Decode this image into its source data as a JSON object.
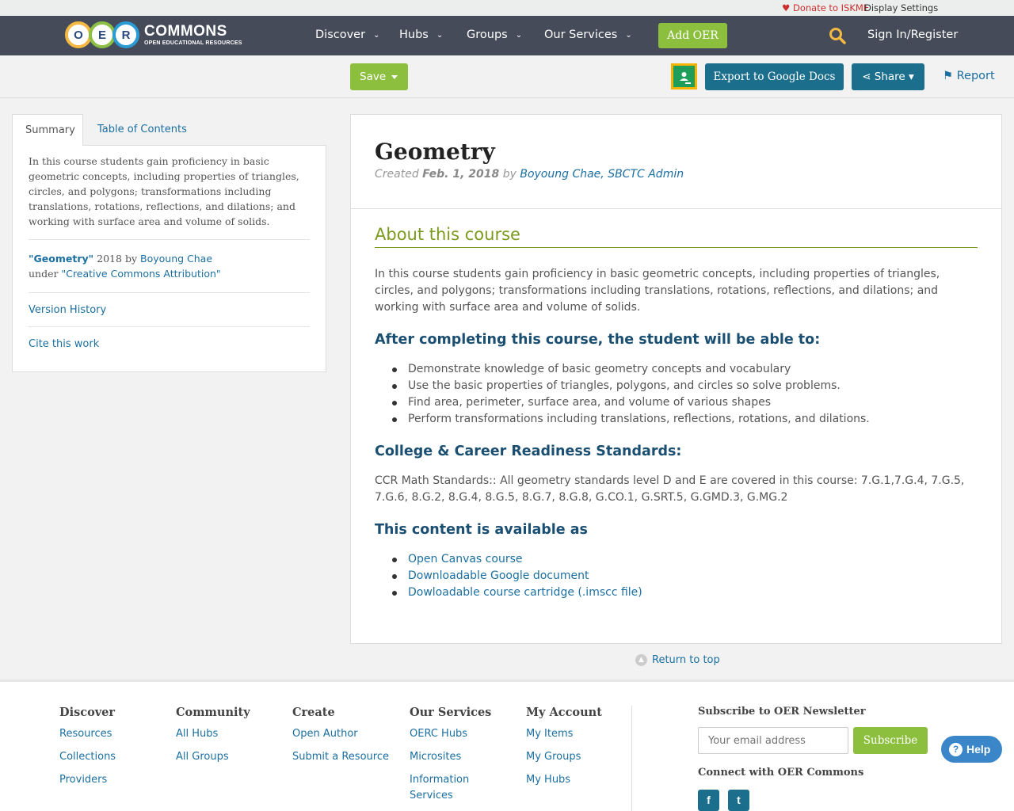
{
  "utility": {
    "donate": "Donate to ISKME",
    "display_settings": "Display Settings"
  },
  "logo": {
    "letters": [
      "O",
      "E",
      "R"
    ],
    "name": "COMMONS",
    "tagline": "OPEN EDUCATIONAL RESOURCES"
  },
  "nav": {
    "items": [
      {
        "label": "Discover"
      },
      {
        "label": "Hubs"
      },
      {
        "label": "Groups"
      },
      {
        "label": "Our Services"
      }
    ],
    "add_oer": "Add OER",
    "sign_in": "Sign In/Register"
  },
  "toolbar": {
    "save": "Save",
    "export": "Export to Google Docs",
    "share": "Share",
    "report": "Report"
  },
  "sidebar": {
    "tabs": [
      {
        "label": "Summary"
      },
      {
        "label": "Table of Contents"
      }
    ],
    "summary": "In this course students gain proficiency in basic geometric concepts, including properties of triangles, circles, and polygons; transformations including translations, rotations, reflections, and dilations; and working with surface area and volume of solids.",
    "attribution": {
      "title": "\"Geometry\"",
      "year": "2018",
      "by": "by",
      "author": "Boyoung Chae",
      "under": "under",
      "license": "\"Creative Commons Attribution\""
    },
    "version_history": "Version History",
    "cite": "Cite this work"
  },
  "resource": {
    "title": "Geometry",
    "created_label": "Created",
    "created_date": "Feb. 1, 2018",
    "by_label": "by",
    "authors": "Boyoung Chae, SBCTC Admin",
    "about_heading": "About this course",
    "about_text": "In this course students gain proficiency in basic geometric concepts, including properties of triangles, circles, and polygons; transformations including translations, rotations, reflections, and dilations; and working with surface area and volume of solids.",
    "outcomes_heading": "After completing this course, the student will be able to:",
    "outcomes": [
      "Demonstrate knowledge of basic geometry concepts and vocabulary",
      "Use the basic properties of triangles, polygons, and circles so solve problems.",
      "Find area, perimeter, surface area, and volume of various shapes",
      "Perform transformations including translations, reflections, rotations, and dilations."
    ],
    "standards_heading": "College & Career Readiness Standards:",
    "standards_text": "CCR Math Standards:: All geometry standards level D and E are covered in this course: 7.G.1,7.G.4, 7.G.5, 7.G.6, 8.G.2, 8.G.4, 8.G.5, 8.G.7, 8.G.8, G.CO.1, G.SRT.5, G.GMD.3, G.MG.2",
    "available_heading": "This content is available as",
    "available": [
      "Open Canvas course",
      "Downloadable Google document",
      "Dowloadable course cartridge (.imscc file)"
    ]
  },
  "return_top": "Return to top",
  "footer": {
    "columns": [
      {
        "heading": "Discover",
        "links": [
          "Resources",
          "Collections",
          "Providers"
        ]
      },
      {
        "heading": "Community",
        "links": [
          "All Hubs",
          "All Groups"
        ]
      },
      {
        "heading": "Create",
        "links": [
          "Open Author",
          "Submit a Resource"
        ]
      },
      {
        "heading": "Our Services",
        "links": [
          "OERC Hubs",
          "Microsites",
          "Information Services"
        ]
      },
      {
        "heading": "My Account",
        "links": [
          "My Items",
          "My Groups",
          "My Hubs"
        ]
      }
    ],
    "newsletter_heading": "Subscribe to OER Newsletter",
    "email_placeholder": "Your email address",
    "subscribe": "Subscribe",
    "connect_heading": "Connect with OER Commons"
  },
  "help": "Help",
  "colors": {
    "nav_bg": "#454b59",
    "green": "#8dbf3f",
    "teal": "#1b6f8c",
    "link": "#1b6fa0",
    "heading_green": "#7b9a1e",
    "heading_blue": "#1b4f72"
  }
}
